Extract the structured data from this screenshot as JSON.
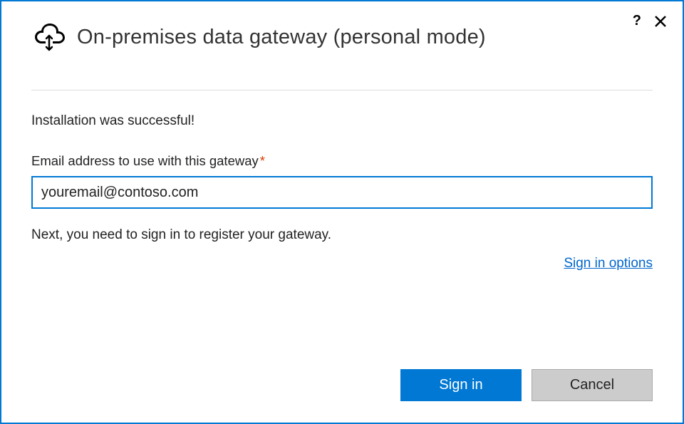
{
  "header": {
    "title": "On-premises data gateway (personal mode)"
  },
  "body": {
    "status_message": "Installation was successful!",
    "email_label": "Email address to use with this gateway",
    "required_marker": "*",
    "email_value": "youremail@contoso.com",
    "instruction_text": "Next, you need to sign in to register your gateway.",
    "options_link": "Sign in options"
  },
  "footer": {
    "primary_label": "Sign in",
    "secondary_label": "Cancel"
  },
  "colors": {
    "accent": "#0078d4",
    "link": "#0066cc",
    "required": "#d83b01"
  }
}
